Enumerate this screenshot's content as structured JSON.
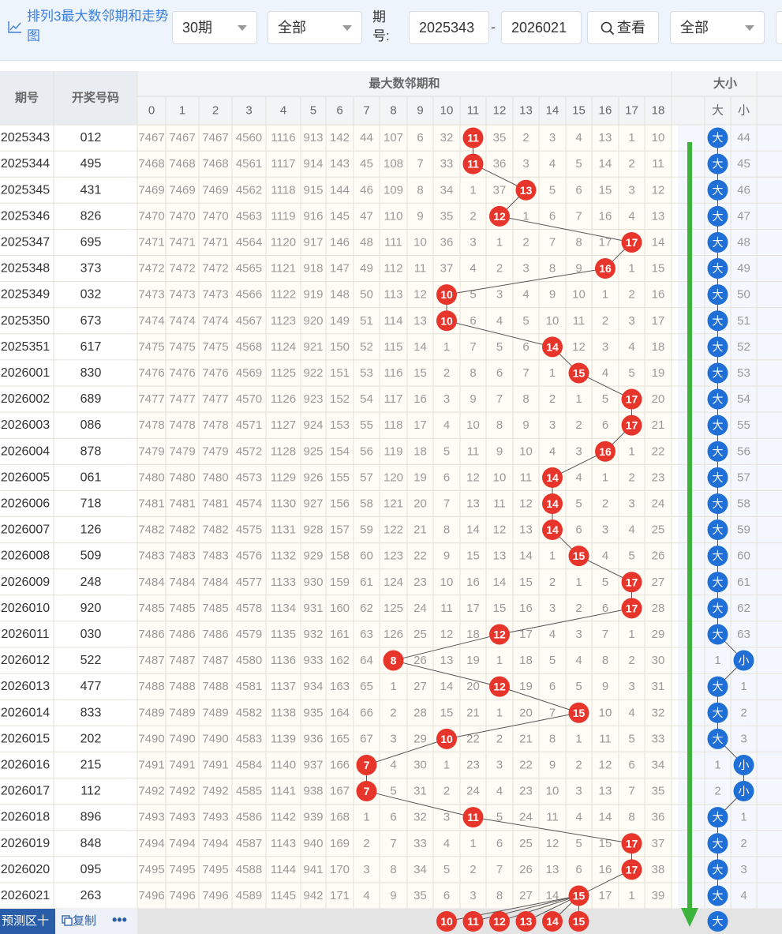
{
  "toolbar": {
    "title": "排列3最大数邻期和走势图",
    "period_select": "30期",
    "filter_select": "全部",
    "issue_label": "期号:",
    "issue_from": "2025343",
    "issue_to": "2026021",
    "issue_separator": "-",
    "view_button": "查看",
    "filter_select2": "全部"
  },
  "table": {
    "col_issue": "期号",
    "col_number": "开奖号码",
    "group_sum": "最大数邻期和",
    "group_bs": "大小",
    "sum_columns": [
      "0",
      "1",
      "2",
      "3",
      "4",
      "5",
      "6",
      "7",
      "8",
      "9",
      "10",
      "11",
      "12",
      "13",
      "14",
      "15",
      "16",
      "17",
      "18"
    ],
    "bs_columns": [
      "大",
      "小"
    ],
    "rows": [
      {
        "issue": "2025343",
        "num": "012",
        "cells": [
          "7467",
          "7467",
          "7467",
          "4560",
          "1116",
          "913",
          "142",
          "44",
          "107",
          "6",
          "32",
          "11",
          "35",
          "2",
          "3",
          "4",
          "13",
          "1",
          "10"
        ],
        "hit": 11,
        "bs": [
          "大",
          "44"
        ],
        "bs_hit": 0
      },
      {
        "issue": "2025344",
        "num": "495",
        "cells": [
          "7468",
          "7468",
          "7468",
          "4561",
          "1117",
          "914",
          "143",
          "45",
          "108",
          "7",
          "33",
          "11",
          "36",
          "3",
          "4",
          "5",
          "14",
          "2",
          "11"
        ],
        "hit": 11,
        "bs": [
          "大",
          "45"
        ],
        "bs_hit": 0
      },
      {
        "issue": "2025345",
        "num": "431",
        "cells": [
          "7469",
          "7469",
          "7469",
          "4562",
          "1118",
          "915",
          "144",
          "46",
          "109",
          "8",
          "34",
          "1",
          "37",
          "13",
          "5",
          "6",
          "15",
          "3",
          "12"
        ],
        "hit": 13,
        "bs": [
          "大",
          "46"
        ],
        "bs_hit": 0
      },
      {
        "issue": "2025346",
        "num": "826",
        "cells": [
          "7470",
          "7470",
          "7470",
          "4563",
          "1119",
          "916",
          "145",
          "47",
          "110",
          "9",
          "35",
          "2",
          "12",
          "1",
          "6",
          "7",
          "16",
          "4",
          "13"
        ],
        "hit": 12,
        "bs": [
          "大",
          "47"
        ],
        "bs_hit": 0
      },
      {
        "issue": "2025347",
        "num": "695",
        "cells": [
          "7471",
          "7471",
          "7471",
          "4564",
          "1120",
          "917",
          "146",
          "48",
          "111",
          "10",
          "36",
          "3",
          "1",
          "2",
          "7",
          "8",
          "17",
          "17",
          "14"
        ],
        "hit": 17,
        "bs": [
          "大",
          "48"
        ],
        "bs_hit": 0
      },
      {
        "issue": "2025348",
        "num": "373",
        "cells": [
          "7472",
          "7472",
          "7472",
          "4565",
          "1121",
          "918",
          "147",
          "49",
          "112",
          "11",
          "37",
          "4",
          "2",
          "3",
          "8",
          "9",
          "16",
          "1",
          "15"
        ],
        "hit": 16,
        "bs": [
          "大",
          "49"
        ],
        "bs_hit": 0
      },
      {
        "issue": "2025349",
        "num": "032",
        "cells": [
          "7473",
          "7473",
          "7473",
          "4566",
          "1122",
          "919",
          "148",
          "50",
          "113",
          "12",
          "10",
          "5",
          "3",
          "4",
          "9",
          "10",
          "1",
          "2",
          "16"
        ],
        "hit": 10,
        "bs": [
          "大",
          "50"
        ],
        "bs_hit": 0
      },
      {
        "issue": "2025350",
        "num": "673",
        "cells": [
          "7474",
          "7474",
          "7474",
          "4567",
          "1123",
          "920",
          "149",
          "51",
          "114",
          "13",
          "10",
          "6",
          "4",
          "5",
          "10",
          "11",
          "2",
          "3",
          "17"
        ],
        "hit": 10,
        "bs": [
          "大",
          "51"
        ],
        "bs_hit": 0
      },
      {
        "issue": "2025351",
        "num": "617",
        "cells": [
          "7475",
          "7475",
          "7475",
          "4568",
          "1124",
          "921",
          "150",
          "52",
          "115",
          "14",
          "1",
          "7",
          "5",
          "6",
          "14",
          "12",
          "3",
          "4",
          "18"
        ],
        "hit": 14,
        "bs": [
          "大",
          "52"
        ],
        "bs_hit": 0
      },
      {
        "issue": "2026001",
        "num": "830",
        "cells": [
          "7476",
          "7476",
          "7476",
          "4569",
          "1125",
          "922",
          "151",
          "53",
          "116",
          "15",
          "2",
          "8",
          "6",
          "7",
          "1",
          "15",
          "4",
          "5",
          "19"
        ],
        "hit": 15,
        "bs": [
          "大",
          "53"
        ],
        "bs_hit": 0
      },
      {
        "issue": "2026002",
        "num": "689",
        "cells": [
          "7477",
          "7477",
          "7477",
          "4570",
          "1126",
          "923",
          "152",
          "54",
          "117",
          "16",
          "3",
          "9",
          "7",
          "8",
          "2",
          "1",
          "5",
          "17",
          "20"
        ],
        "hit": 17,
        "bs": [
          "大",
          "54"
        ],
        "bs_hit": 0
      },
      {
        "issue": "2026003",
        "num": "086",
        "cells": [
          "7478",
          "7478",
          "7478",
          "4571",
          "1127",
          "924",
          "153",
          "55",
          "118",
          "17",
          "4",
          "10",
          "8",
          "9",
          "3",
          "2",
          "6",
          "17",
          "21"
        ],
        "hit": 17,
        "bs": [
          "大",
          "55"
        ],
        "bs_hit": 0
      },
      {
        "issue": "2026004",
        "num": "878",
        "cells": [
          "7479",
          "7479",
          "7479",
          "4572",
          "1128",
          "925",
          "154",
          "56",
          "119",
          "18",
          "5",
          "11",
          "9",
          "10",
          "4",
          "3",
          "16",
          "1",
          "22"
        ],
        "hit": 16,
        "bs": [
          "大",
          "56"
        ],
        "bs_hit": 0
      },
      {
        "issue": "2026005",
        "num": "061",
        "cells": [
          "7480",
          "7480",
          "7480",
          "4573",
          "1129",
          "926",
          "155",
          "57",
          "120",
          "19",
          "6",
          "12",
          "10",
          "11",
          "14",
          "4",
          "1",
          "2",
          "23"
        ],
        "hit": 14,
        "bs": [
          "大",
          "57"
        ],
        "bs_hit": 0
      },
      {
        "issue": "2026006",
        "num": "718",
        "cells": [
          "7481",
          "7481",
          "7481",
          "4574",
          "1130",
          "927",
          "156",
          "58",
          "121",
          "20",
          "7",
          "13",
          "11",
          "12",
          "14",
          "5",
          "2",
          "3",
          "24"
        ],
        "hit": 14,
        "bs": [
          "大",
          "58"
        ],
        "bs_hit": 0
      },
      {
        "issue": "2026007",
        "num": "126",
        "cells": [
          "7482",
          "7482",
          "7482",
          "4575",
          "1131",
          "928",
          "157",
          "59",
          "122",
          "21",
          "8",
          "14",
          "12",
          "13",
          "14",
          "6",
          "3",
          "4",
          "25"
        ],
        "hit": 14,
        "bs": [
          "大",
          "59"
        ],
        "bs_hit": 0
      },
      {
        "issue": "2026008",
        "num": "509",
        "cells": [
          "7483",
          "7483",
          "7483",
          "4576",
          "1132",
          "929",
          "158",
          "60",
          "123",
          "22",
          "9",
          "15",
          "13",
          "14",
          "1",
          "15",
          "4",
          "5",
          "26"
        ],
        "hit": 15,
        "bs": [
          "大",
          "60"
        ],
        "bs_hit": 0
      },
      {
        "issue": "2026009",
        "num": "248",
        "cells": [
          "7484",
          "7484",
          "7484",
          "4577",
          "1133",
          "930",
          "159",
          "61",
          "124",
          "23",
          "10",
          "16",
          "14",
          "15",
          "2",
          "1",
          "5",
          "17",
          "27"
        ],
        "hit": 17,
        "bs": [
          "大",
          "61"
        ],
        "bs_hit": 0
      },
      {
        "issue": "2026010",
        "num": "920",
        "cells": [
          "7485",
          "7485",
          "7485",
          "4578",
          "1134",
          "931",
          "160",
          "62",
          "125",
          "24",
          "11",
          "17",
          "15",
          "16",
          "3",
          "2",
          "6",
          "17",
          "28"
        ],
        "hit": 17,
        "bs": [
          "大",
          "62"
        ],
        "bs_hit": 0
      },
      {
        "issue": "2026011",
        "num": "030",
        "cells": [
          "7486",
          "7486",
          "7486",
          "4579",
          "1135",
          "932",
          "161",
          "63",
          "126",
          "25",
          "12",
          "18",
          "12",
          "17",
          "4",
          "3",
          "7",
          "1",
          "29"
        ],
        "hit": 12,
        "bs": [
          "大",
          "63"
        ],
        "bs_hit": 0
      },
      {
        "issue": "2026012",
        "num": "522",
        "cells": [
          "7487",
          "7487",
          "7487",
          "4580",
          "1136",
          "933",
          "162",
          "64",
          "8",
          "26",
          "13",
          "19",
          "1",
          "18",
          "5",
          "4",
          "8",
          "2",
          "30"
        ],
        "hit": 8,
        "bs": [
          "1",
          "小"
        ],
        "bs_hit": 1
      },
      {
        "issue": "2026013",
        "num": "477",
        "cells": [
          "7488",
          "7488",
          "7488",
          "4581",
          "1137",
          "934",
          "163",
          "65",
          "1",
          "27",
          "14",
          "20",
          "12",
          "19",
          "6",
          "5",
          "9",
          "3",
          "31"
        ],
        "hit": 12,
        "bs": [
          "大",
          "1"
        ],
        "bs_hit": 0
      },
      {
        "issue": "2026014",
        "num": "833",
        "cells": [
          "7489",
          "7489",
          "7489",
          "4582",
          "1138",
          "935",
          "164",
          "66",
          "2",
          "28",
          "15",
          "21",
          "1",
          "20",
          "7",
          "15",
          "10",
          "4",
          "32"
        ],
        "hit": 15,
        "bs": [
          "大",
          "2"
        ],
        "bs_hit": 0
      },
      {
        "issue": "2026015",
        "num": "202",
        "cells": [
          "7490",
          "7490",
          "7490",
          "4583",
          "1139",
          "936",
          "165",
          "67",
          "3",
          "29",
          "10",
          "22",
          "2",
          "21",
          "8",
          "1",
          "11",
          "5",
          "33"
        ],
        "hit": 10,
        "bs": [
          "大",
          "3"
        ],
        "bs_hit": 0
      },
      {
        "issue": "2026016",
        "num": "215",
        "cells": [
          "7491",
          "7491",
          "7491",
          "4584",
          "1140",
          "937",
          "166",
          "7",
          "4",
          "30",
          "1",
          "23",
          "3",
          "22",
          "9",
          "2",
          "12",
          "6",
          "34"
        ],
        "hit": 7,
        "bs": [
          "1",
          "小"
        ],
        "bs_hit": 1
      },
      {
        "issue": "2026017",
        "num": "112",
        "cells": [
          "7492",
          "7492",
          "7492",
          "4585",
          "1141",
          "938",
          "167",
          "7",
          "5",
          "31",
          "2",
          "24",
          "4",
          "23",
          "10",
          "3",
          "13",
          "7",
          "35"
        ],
        "hit": 7,
        "bs": [
          "2",
          "小"
        ],
        "bs_hit": 1
      },
      {
        "issue": "2026018",
        "num": "896",
        "cells": [
          "7493",
          "7493",
          "7493",
          "4586",
          "1142",
          "939",
          "168",
          "1",
          "6",
          "32",
          "3",
          "11",
          "5",
          "24",
          "11",
          "4",
          "14",
          "8",
          "36"
        ],
        "hit": 11,
        "bs": [
          "大",
          "1"
        ],
        "bs_hit": 0
      },
      {
        "issue": "2026019",
        "num": "848",
        "cells": [
          "7494",
          "7494",
          "7494",
          "4587",
          "1143",
          "940",
          "169",
          "2",
          "7",
          "33",
          "4",
          "1",
          "6",
          "25",
          "12",
          "5",
          "15",
          "17",
          "37"
        ],
        "hit": 17,
        "bs": [
          "大",
          "2"
        ],
        "bs_hit": 0
      },
      {
        "issue": "2026020",
        "num": "095",
        "cells": [
          "7495",
          "7495",
          "7495",
          "4588",
          "1144",
          "941",
          "170",
          "3",
          "8",
          "34",
          "5",
          "2",
          "7",
          "26",
          "13",
          "6",
          "16",
          "17",
          "38"
        ],
        "hit": 17,
        "bs": [
          "大",
          "3"
        ],
        "bs_hit": 0
      },
      {
        "issue": "2026021",
        "num": "263",
        "cells": [
          "7496",
          "7496",
          "7496",
          "4589",
          "1145",
          "942",
          "171",
          "4",
          "9",
          "35",
          "6",
          "3",
          "8",
          "27",
          "14",
          "15",
          "17",
          "1",
          "39"
        ],
        "hit": 15,
        "bs": [
          "大",
          "4"
        ],
        "bs_hit": 0
      }
    ],
    "predict_balls": [
      "10",
      "11",
      "12",
      "13",
      "14",
      "15"
    ],
    "predict_bs": "大"
  },
  "footer": {
    "predict_label": "预测区",
    "plus": "十",
    "copy_label": "复制",
    "more_label": "•••"
  },
  "colors": {
    "ball_red": "#e8352c",
    "ball_blue": "#1f6fd6",
    "arrow_green": "#3cb43c",
    "accent": "#3d7fd8"
  }
}
